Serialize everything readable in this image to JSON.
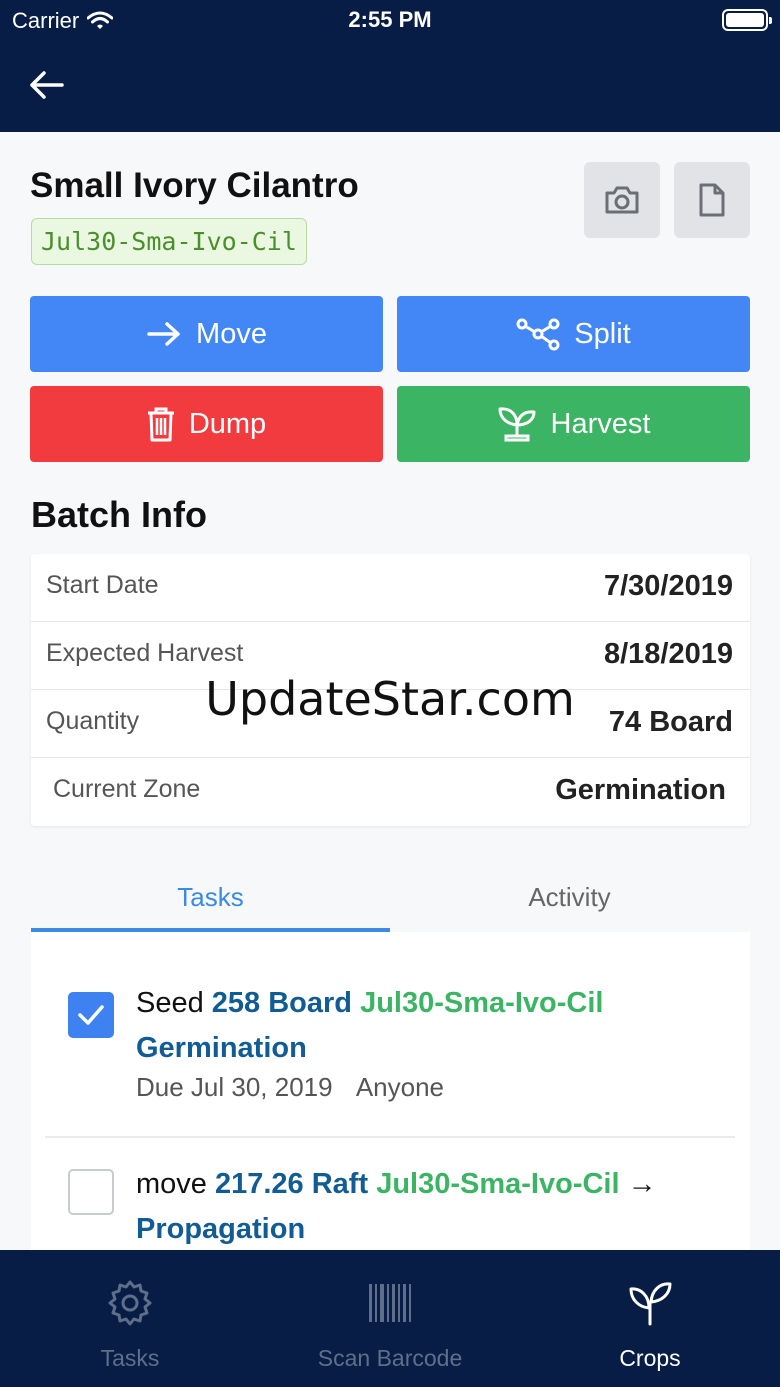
{
  "status_bar": {
    "carrier": "Carrier",
    "time": "2:55 PM"
  },
  "header": {
    "back_icon": "arrow-left-icon"
  },
  "crop": {
    "name": "Small Ivory Cilantro",
    "code": "Jul30-Sma-Ivo-Cil",
    "camera_icon": "camera-icon",
    "document_icon": "document-icon"
  },
  "actions": {
    "move": {
      "label": "Move",
      "icon": "arrow-right-icon",
      "color": "#4287f5"
    },
    "split": {
      "label": "Split",
      "icon": "split-icon",
      "color": "#4287f5"
    },
    "dump": {
      "label": "Dump",
      "icon": "trash-icon",
      "color": "#f23b3f"
    },
    "harvest": {
      "label": "Harvest",
      "icon": "sprout-icon",
      "color": "#3bb463"
    }
  },
  "batch_info": {
    "title": "Batch Info",
    "rows": [
      {
        "label": "Start Date",
        "value": "7/30/2019"
      },
      {
        "label": "Expected Harvest",
        "value": "8/18/2019"
      },
      {
        "label": "Quantity",
        "value": "74 Board"
      },
      {
        "label": "Current Zone",
        "value": "Germination"
      }
    ]
  },
  "watermark": "UpdateStar.com",
  "tabs": {
    "tasks": "Tasks",
    "activity": "Activity",
    "active": "Tasks"
  },
  "tasks": [
    {
      "checked": true,
      "verb": "Seed",
      "quantity": "258 Board",
      "code": "Jul30-Sma-Ivo-Cil",
      "zone": "Germination",
      "due": "Due Jul 30, 2019",
      "assignee": "Anyone"
    },
    {
      "checked": false,
      "verb": "move",
      "quantity": "217.26 Raft",
      "code": "Jul30-Sma-Ivo-Cil",
      "arrow": "→",
      "zone": "Propagation"
    }
  ],
  "bottom_nav": [
    {
      "label": "Tasks",
      "icon": "gear-icon",
      "active": false
    },
    {
      "label": "Scan Barcode",
      "icon": "barcode-icon",
      "active": false
    },
    {
      "label": "Crops",
      "icon": "sprout-icon",
      "active": true
    }
  ],
  "colors": {
    "header_bg": "#081d46",
    "link_blue": "#125c96",
    "accent_green": "#3bb463",
    "tab_active": "#3b8ae4"
  }
}
